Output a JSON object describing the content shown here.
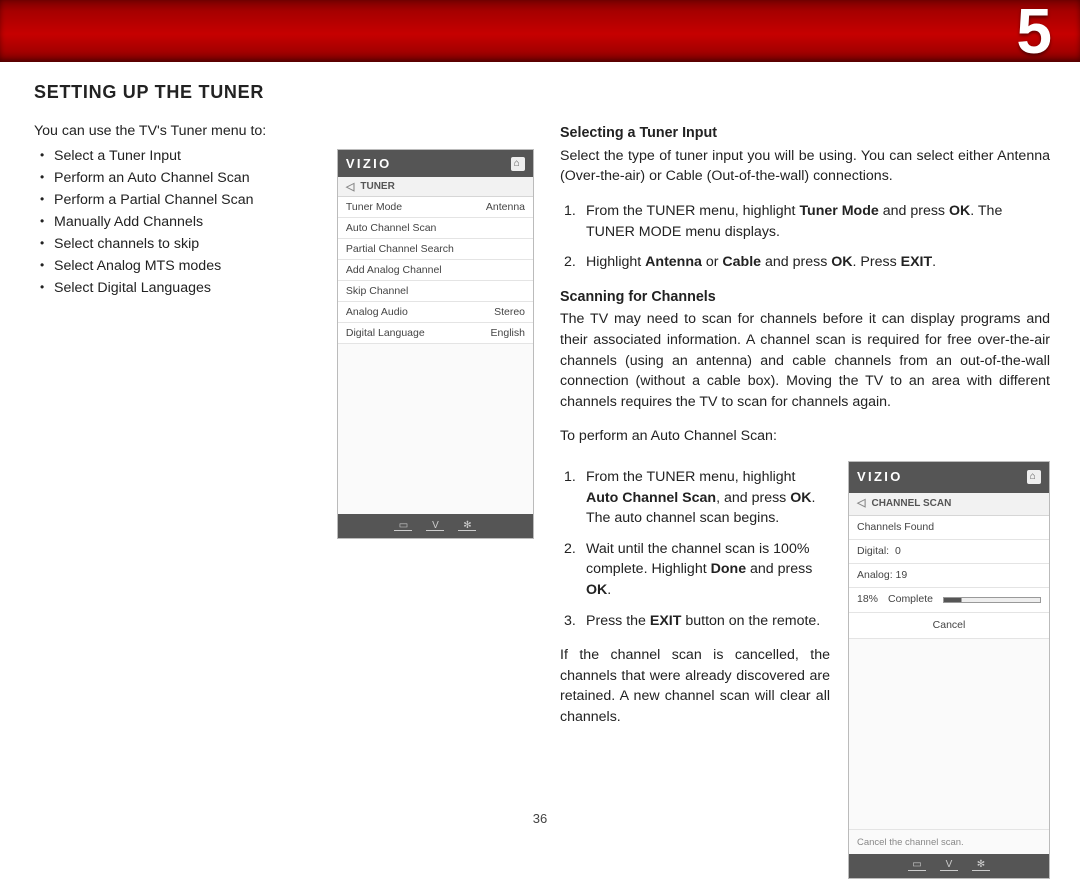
{
  "chapter_number": "5",
  "page_number": "36",
  "section_title": "SETTING UP THE TUNER",
  "intro_line": "You can use the TV's Tuner menu to:",
  "left_bullets": [
    "Select a Tuner Input",
    "Perform an Auto Channel Scan",
    "Perform a Partial Channel Scan",
    "Manually Add Channels",
    "Select channels to skip",
    "Select Analog MTS modes",
    "Select Digital Languages"
  ],
  "selecting": {
    "heading": "Selecting a Tuner Input",
    "intro": "Select the type of tuner input you will be using. You can select either Antenna (Over-the-air) or Cable (Out-of-the-wall) connections.",
    "s1_pre": "From the TUNER menu, highlight ",
    "s1_b1": "Tuner Mode",
    "s1_mid1": " and press ",
    "s1_b2": "OK",
    "s1_post": ". The TUNER MODE menu displays.",
    "s2_pre": "Highlight ",
    "s2_b1": "Antenna",
    "s2_mid1": " or ",
    "s2_b2": "Cable",
    "s2_mid2": " and press ",
    "s2_b3": "OK",
    "s2_mid3": ". Press ",
    "s2_b4": "EXIT",
    "s2_post": "."
  },
  "scanning": {
    "heading": "Scanning for Channels",
    "para1": "The TV may need to scan for channels before it can display programs and their associated information. A channel scan is required for free over-the-air channels (using an antenna) and cable channels from an out-of-the-wall connection (without a cable box). Moving the TV to an area with different channels requires the TV to scan for channels again.",
    "intro2": "To perform an Auto Channel Scan:",
    "s1_pre": "From the TUNER menu, highlight ",
    "s1_b1": "Auto Channel Scan",
    "s1_mid1": ", and press ",
    "s1_b2": "OK",
    "s1_post": ". The auto channel scan begins.",
    "s2_pre": "Wait until the channel scan is 100% complete. Highlight ",
    "s2_b1": "Done",
    "s2_mid1": " and press ",
    "s2_b2": "OK",
    "s2_post": ".",
    "s3_pre": "Press the ",
    "s3_b1": "EXIT",
    "s3_post": " button on the remote.",
    "para2": "If the channel scan is cancelled, the channels that were already discovered are retained. A new channel scan will clear all channels."
  },
  "tuner_menu": {
    "brand": "VIZIO",
    "crumb": "TUNER",
    "rows": [
      {
        "label": "Tuner Mode",
        "value": "Antenna"
      },
      {
        "label": "Auto Channel Scan",
        "value": ""
      },
      {
        "label": "Partial Channel Search",
        "value": ""
      },
      {
        "label": "Add Analog Channel",
        "value": ""
      },
      {
        "label": "Skip Channel",
        "value": ""
      },
      {
        "label": "Analog Audio",
        "value": "Stereo"
      },
      {
        "label": "Digital Language",
        "value": "English"
      }
    ]
  },
  "scan_menu": {
    "brand": "VIZIO",
    "crumb": "CHANNEL SCAN",
    "found_label": "Channels Found",
    "digital_label": "Digital:",
    "digital_value": "0",
    "analog_label": "Analog:",
    "analog_value": "19",
    "percent": "18%",
    "complete_label": "Complete",
    "cancel_label": "Cancel",
    "tip": "Cancel the channel scan."
  }
}
